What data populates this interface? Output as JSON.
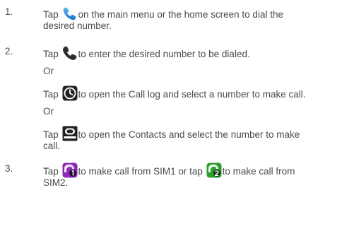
{
  "steps": [
    {
      "number": "1.",
      "lines": [
        "Tap",
        "on the main menu or the home screen to dial the",
        "desired number."
      ],
      "icon": "phone-app-icon"
    },
    {
      "number": "2.",
      "line1_a": "Tap",
      "line1_b": "to enter the desired number to be dialed.",
      "icon": "phone-handset-icon"
    },
    {
      "or_1": "Or",
      "line_a": "Tap",
      "line_b": "to open the Call log and select a number to make call.",
      "icon": "call-log-clock-icon"
    },
    {
      "or_2": "Or",
      "line_a": "Tap",
      "line_b": "to open the Contacts and select the number to make",
      "line_c": "call.",
      "icon": "contacts-icon"
    },
    {
      "number": "3.",
      "line_a": "Tap",
      "line_b": "to make call from SIM1 or tap",
      "line_c": "to make call from",
      "line_d": "SIM2.",
      "icon_sim1": "sim1-call-icon",
      "icon_sim2": "sim2-call-icon"
    }
  ],
  "colors": {
    "text": "#4a4a4a",
    "phone_blue": "#1a73c8",
    "sim1_purple": "#8a2bb8",
    "sim2_green": "#2f9a2f"
  }
}
